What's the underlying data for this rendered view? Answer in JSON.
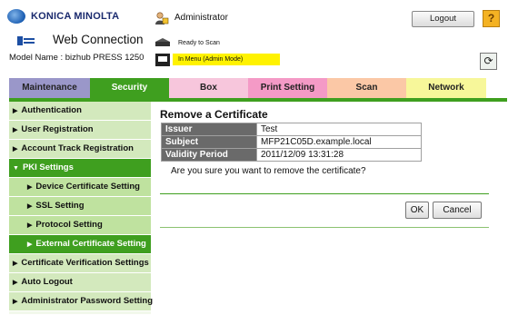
{
  "header": {
    "brand": "KONICA MINOLTA",
    "product": "Web Connection",
    "model": "Model Name : bizhub PRESS 1250",
    "user": "Administrator",
    "status_ready": "Ready to Scan",
    "status_mode": "In Menu (Admin Mode)",
    "logout_label": "Logout",
    "help_label": "?",
    "refresh_label": "⟳"
  },
  "tabs": [
    {
      "label": "Maintenance"
    },
    {
      "label": "Security"
    },
    {
      "label": "Box"
    },
    {
      "label": "Print Setting"
    },
    {
      "label": "Scan"
    },
    {
      "label": "Network"
    }
  ],
  "sidebar": {
    "items": [
      {
        "label": "Authentication"
      },
      {
        "label": "User Registration"
      },
      {
        "label": "Account Track Registration"
      },
      {
        "label": "PKI Settings"
      },
      {
        "label": "Device Certificate Setting"
      },
      {
        "label": "SSL Setting"
      },
      {
        "label": "Protocol Setting"
      },
      {
        "label": "External Certificate Setting"
      },
      {
        "label": "Certificate Verification Settings"
      },
      {
        "label": "Auto Logout"
      },
      {
        "label": "Administrator Password Setting"
      }
    ]
  },
  "main": {
    "title": "Remove a Certificate",
    "rows": [
      {
        "label": "Issuer",
        "value": "Test"
      },
      {
        "label": "Subject",
        "value": "MFP21C05D.example.local"
      },
      {
        "label": "Validity Period",
        "value": "2011/12/09 13:31:28"
      }
    ],
    "confirm_text": "Are you sure you want to remove the certificate?",
    "ok_label": "OK",
    "cancel_label": "Cancel"
  },
  "colors": {
    "security_green": "#3f9f1f",
    "status_yellow": "#fff200"
  }
}
